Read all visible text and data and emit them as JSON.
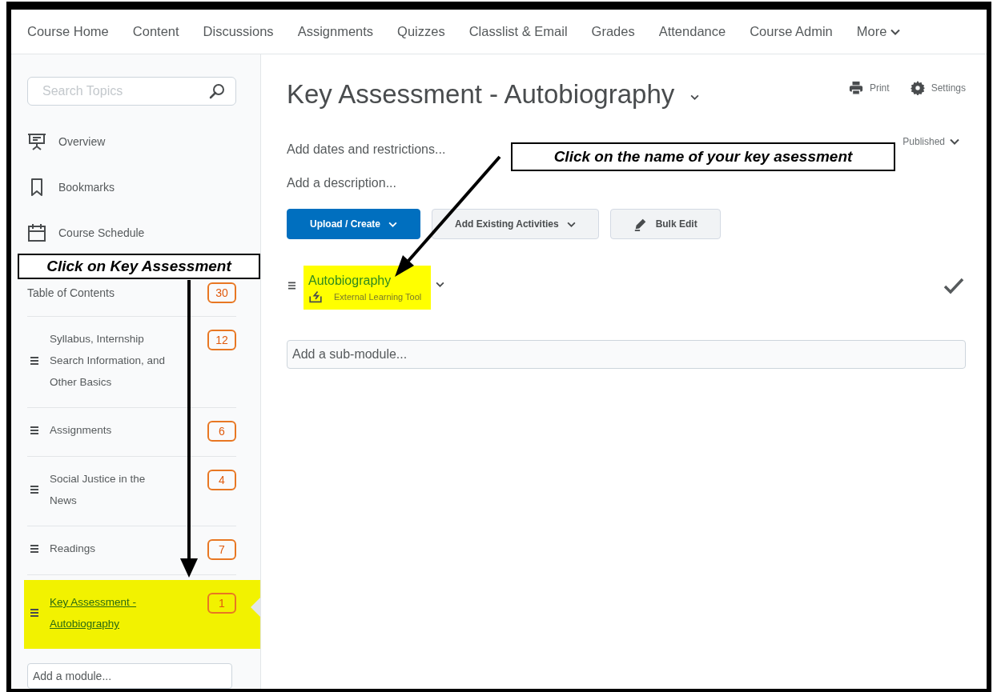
{
  "nav": {
    "items": [
      "Course Home",
      "Content",
      "Discussions",
      "Assignments",
      "Quizzes",
      "Classlist & Email",
      "Grades",
      "Attendance",
      "Course Admin"
    ],
    "more": "More"
  },
  "sidebar": {
    "search": {
      "placeholder": "Search Topics"
    },
    "links": [
      {
        "label": "Overview",
        "kind": "overview"
      },
      {
        "label": "Bookmarks",
        "kind": "bookmark"
      },
      {
        "label": "Course Schedule",
        "kind": "calendar"
      }
    ],
    "toc": {
      "label": "Table of Contents",
      "count": "30"
    },
    "modules": [
      {
        "title": "Syllabus, Internship Search Information, and Other Basics",
        "count": "12",
        "selected": false
      },
      {
        "title": "Assignments",
        "count": "6",
        "selected": false
      },
      {
        "title": "Social Justice in the News",
        "count": "4",
        "selected": false
      },
      {
        "title": "Readings",
        "count": "7",
        "selected": false
      },
      {
        "title": "Key Assessment - Autobiography",
        "count": "1",
        "selected": true
      }
    ],
    "add_module": {
      "placeholder": "Add a module..."
    }
  },
  "main": {
    "title": "Key Assessment - Autobiography",
    "actions": [
      {
        "label": "Print",
        "kind": "print"
      },
      {
        "label": "Settings",
        "kind": "settings"
      }
    ],
    "dates_link": "Add dates and restrictions...",
    "status": "Published",
    "description_link": "Add a description...",
    "buttons": [
      {
        "label": "Upload / Create",
        "kind": "primary"
      },
      {
        "label": "Add Existing Activities",
        "kind": "dropdown"
      },
      {
        "label": "Bulk Edit",
        "kind": "edit"
      }
    ],
    "items": [
      {
        "title": "Autobiography",
        "type": "External Learning Tool",
        "checked": true,
        "highlighted": true
      }
    ],
    "add_submodule": {
      "placeholder": "Add a sub-module..."
    }
  },
  "annotations": [
    {
      "text": "Click on Key Assessment",
      "kind": "left"
    },
    {
      "text": "Click on the name of your key asessment",
      "kind": "right"
    }
  ]
}
